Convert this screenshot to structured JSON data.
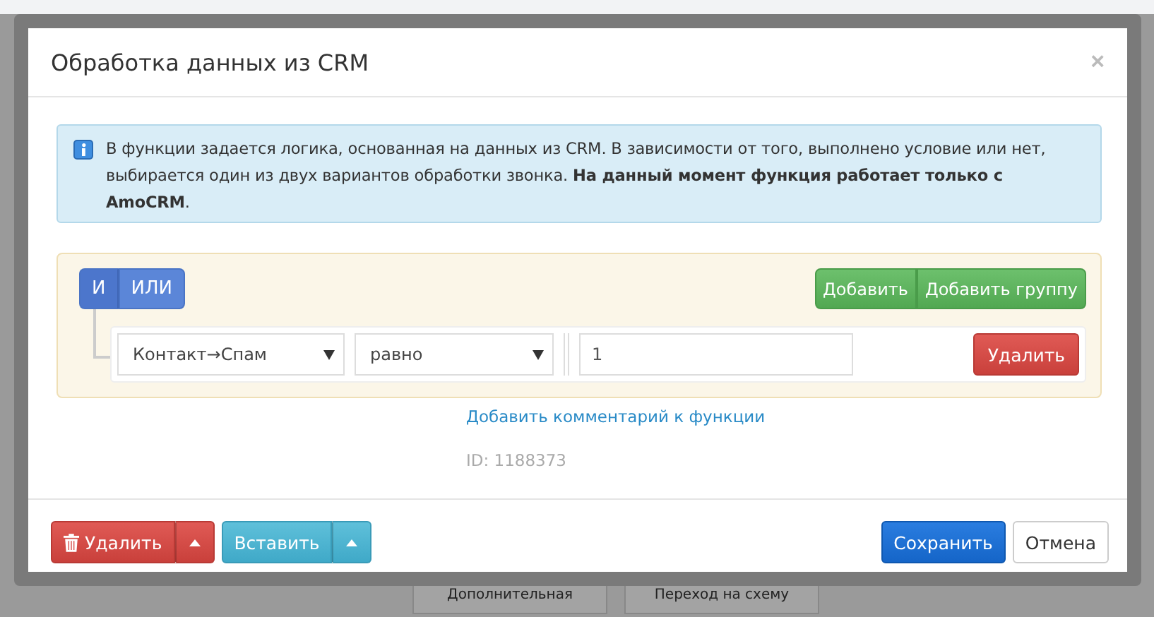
{
  "dialog": {
    "title": "Обработка данных из CRM",
    "close": "×"
  },
  "info": {
    "text": "В функции задается логика, основанная на данных из CRM. В зависимости от того, выполнено условие или нет, выбирается один из двух вариантов обработки звонка. **На данный момент функция работает только с AmoCRM**."
  },
  "group": {
    "conditions": [
      {
        "label": "И",
        "selected": true
      },
      {
        "label": "ИЛИ",
        "selected": false
      }
    ],
    "actions": [
      "Добавить",
      "Добавить группу"
    ],
    "rules": [
      {
        "field": "Контакт→Спам",
        "operator": "равно",
        "value": "1",
        "delete": "Удалить"
      }
    ]
  },
  "comment_link": "Добавить комментарий к функции",
  "id_label": "ID: 1188373",
  "footer": {
    "left": [
      {
        "label": "Удалить",
        "kind": "danger"
      },
      {
        "label": "Вставить",
        "kind": "info"
      }
    ],
    "right": [
      {
        "label": "Сохранить",
        "kind": "primary"
      },
      {
        "label": "Отмена",
        "kind": "default"
      }
    ]
  },
  "background": [
    "Дополнительная",
    "Переход на схему"
  ]
}
